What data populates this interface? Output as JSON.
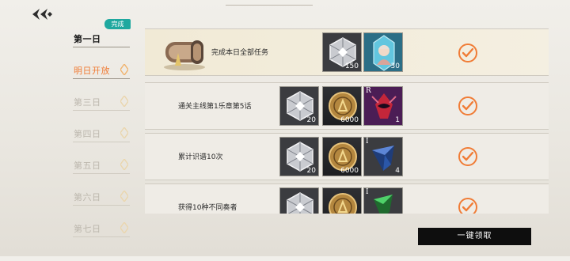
{
  "nav": {
    "back_icon": "double-chevron-left-icon"
  },
  "days": [
    {
      "label": "第一日",
      "state": "done",
      "badge": "完成"
    },
    {
      "label": "明日开放",
      "state": "active",
      "badge": ""
    },
    {
      "label": "第三日",
      "state": "locked",
      "badge": ""
    },
    {
      "label": "第四日",
      "state": "locked",
      "badge": ""
    },
    {
      "label": "第五日",
      "state": "locked",
      "badge": ""
    },
    {
      "label": "第六日",
      "state": "locked",
      "badge": ""
    },
    {
      "label": "第七日",
      "state": "locked",
      "badge": ""
    }
  ],
  "tasks": [
    {
      "title": "完成本日全部任务",
      "rewards": [
        {
          "icon": "silver-crystal-icon",
          "count": "150",
          "tag": ""
        },
        {
          "icon": "character-card-icon",
          "count": "30",
          "tag": ""
        }
      ],
      "status_icon": "check-circle-icon"
    },
    {
      "title": "通关主线第1乐章第5话",
      "rewards": [
        {
          "icon": "silver-crystal-icon",
          "count": "20",
          "tag": ""
        },
        {
          "icon": "gold-coin-icon",
          "count": "6000",
          "tag": ""
        },
        {
          "icon": "red-mask-card-icon",
          "count": "1",
          "tag": "R"
        }
      ],
      "status_icon": "check-circle-icon"
    },
    {
      "title": "累计识谱10次",
      "rewards": [
        {
          "icon": "silver-crystal-icon",
          "count": "20",
          "tag": ""
        },
        {
          "icon": "gold-coin-icon",
          "count": "6000",
          "tag": ""
        },
        {
          "icon": "blue-shard-icon",
          "count": "4",
          "tag": "I"
        }
      ],
      "status_icon": "check-circle-icon"
    },
    {
      "title": "获得10种不同奏者",
      "rewards": [
        {
          "icon": "silver-crystal-icon",
          "count": "",
          "tag": ""
        },
        {
          "icon": "gold-coin-icon",
          "count": "",
          "tag": ""
        },
        {
          "icon": "green-shard-icon",
          "count": "",
          "tag": "I"
        }
      ],
      "status_icon": "check-circle-icon"
    }
  ],
  "claim_all": "一键领取",
  "colors": {
    "accent": "#f07c36",
    "badge": "#1fa89f",
    "button": "#0e0e0e"
  }
}
